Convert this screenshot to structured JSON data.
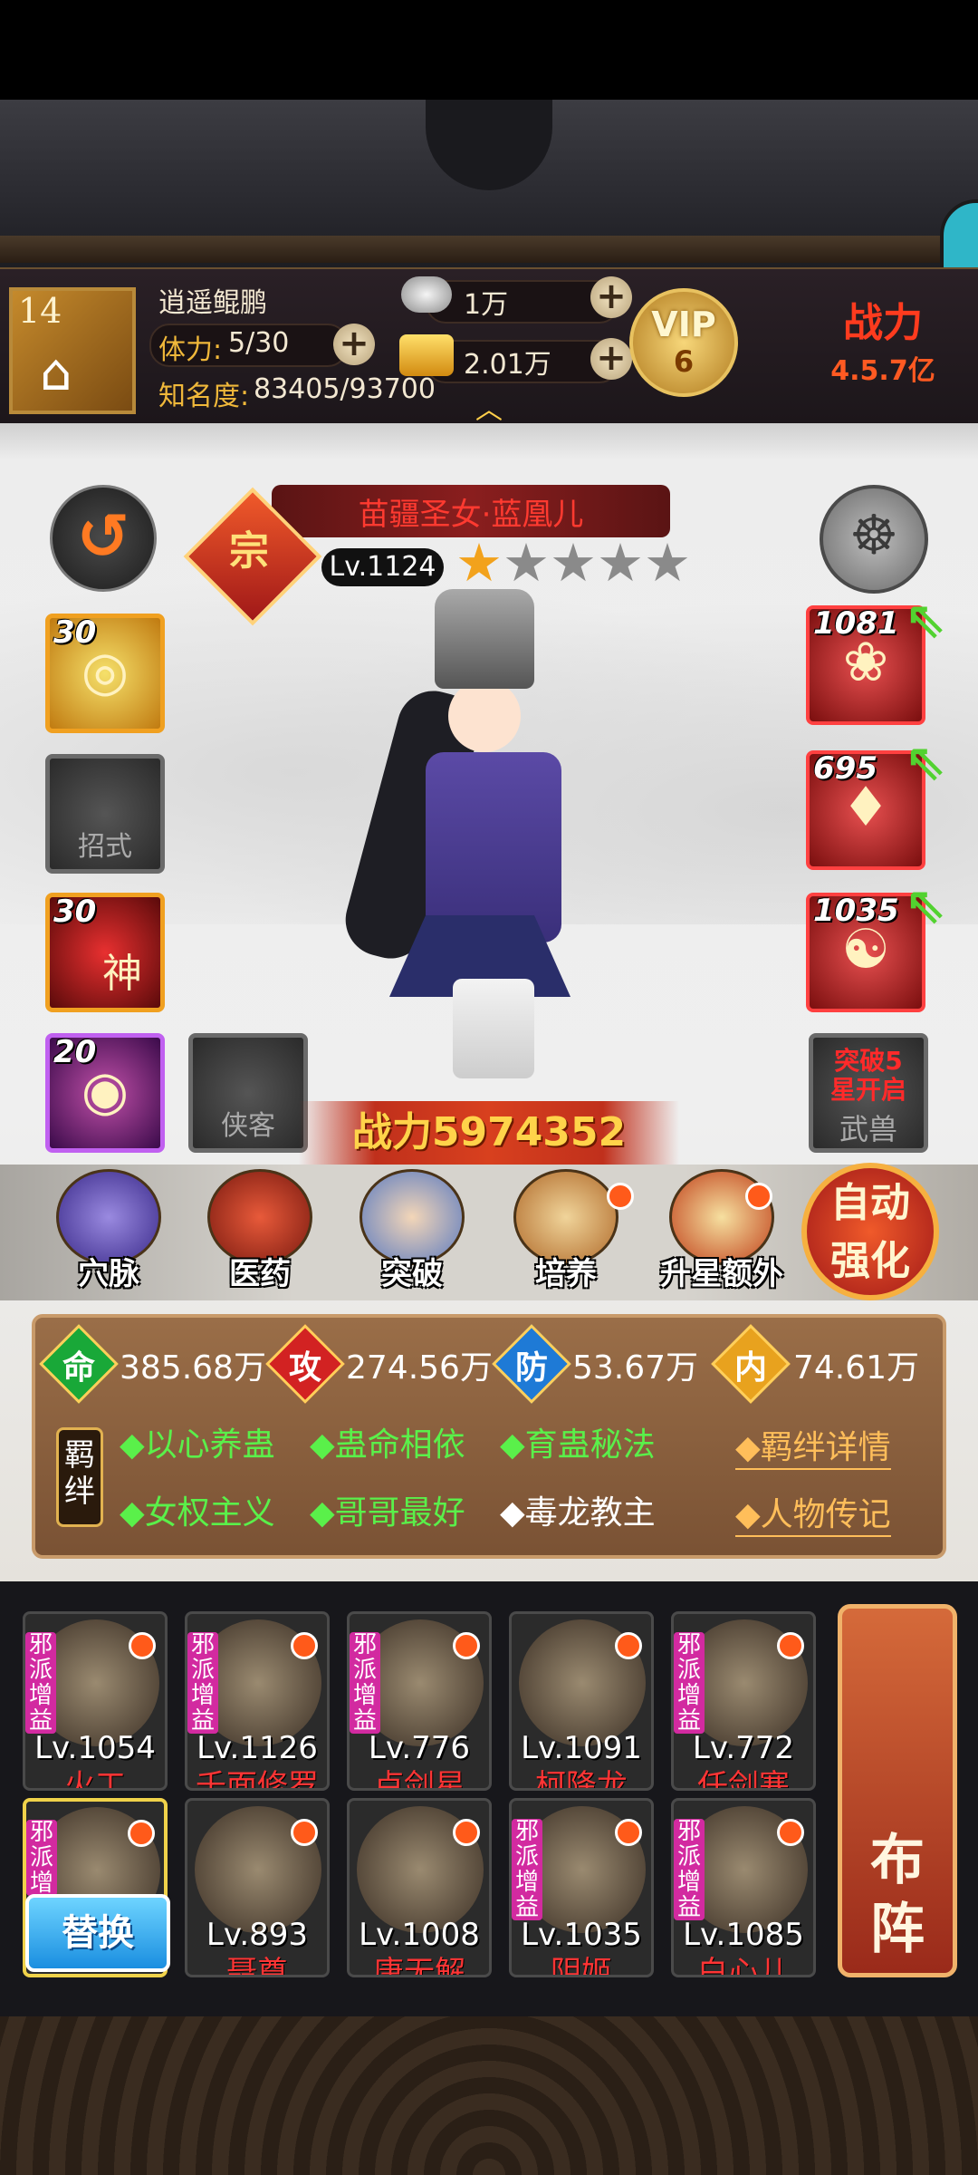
{
  "player": {
    "level": "14",
    "name": "逍遥鲲鹏",
    "stamina_label": "体力:",
    "stamina_value": "5/30",
    "fame_label": "知名度:",
    "fame_value": "83405/93700",
    "silver": "1万",
    "gold": "2.01万",
    "vip_label": "VIP",
    "vip_level": "6",
    "power_label": "战力",
    "power_value": "4.5.7亿"
  },
  "hero": {
    "rank_badge": "宗",
    "name": "苗疆圣女·蓝凰儿",
    "level": "Lv.1124",
    "stars_total": 5,
    "stars_lit": 1,
    "power_text": "战力5974352"
  },
  "skills": [
    {
      "level": "30",
      "type": "gold"
    },
    {
      "caption": "招式",
      "type": "empty"
    },
    {
      "level": "30",
      "type": "red",
      "glyph": "神"
    },
    {
      "level": "20",
      "type": "purple"
    }
  ],
  "xiake_slot": {
    "caption": "侠客"
  },
  "equipment": [
    {
      "level": "1081"
    },
    {
      "level": "695"
    },
    {
      "level": "1035"
    }
  ],
  "wushou": {
    "line1": "突破5",
    "line2": "星开启",
    "caption": "武兽"
  },
  "functions": [
    {
      "label": "穴脉",
      "dot": false
    },
    {
      "label": "医药",
      "dot": false
    },
    {
      "label": "突破",
      "dot": false
    },
    {
      "label": "培养",
      "dot": true
    },
    {
      "label": "升星额外",
      "dot": true
    }
  ],
  "auto_btn": {
    "line1": "自动",
    "line2": "强化"
  },
  "stats": [
    {
      "char": "命",
      "value": "385.68万",
      "color": "#19a838"
    },
    {
      "char": "攻",
      "value": "274.56万",
      "color": "#d22222"
    },
    {
      "char": "防",
      "value": "53.67万",
      "color": "#1e7ad6"
    },
    {
      "char": "内",
      "value": "74.61万",
      "color": "#e8a21e"
    }
  ],
  "fetter_tag": "羁绊",
  "fetters": [
    {
      "text": "◆以心养蛊",
      "active": true
    },
    {
      "text": "◆蛊命相依",
      "active": true
    },
    {
      "text": "◆育蛊秘法",
      "active": true
    },
    {
      "text": "◆女权主义",
      "active": true
    },
    {
      "text": "◆哥哥最好",
      "active": true
    },
    {
      "text": "◆毒龙教主",
      "active": false
    }
  ],
  "fetter_links": [
    "◆羁绊详情",
    "◆人物传记"
  ],
  "team": [
    {
      "level": "Lv.1054",
      "name": "火工",
      "tag": "邪派增益"
    },
    {
      "level": "Lv.1126",
      "name": "千面修罗",
      "tag": "邪派增益"
    },
    {
      "level": "Lv.776",
      "name": "卢剑星",
      "tag": "邪派增益"
    },
    {
      "level": "Lv.1091",
      "name": "柯降龙",
      "tag": ""
    },
    {
      "level": "Lv.772",
      "name": "任剑寒",
      "tag": "邪派增益"
    },
    {
      "level": "",
      "name": "",
      "tag": "邪派增"
    },
    {
      "level": "Lv.893",
      "name": "聂尊",
      "tag": ""
    },
    {
      "level": "Lv.1008",
      "name": "唐无解",
      "tag": ""
    },
    {
      "level": "Lv.1035",
      "name": "阴姬",
      "tag": "邪派增益"
    },
    {
      "level": "Lv.1085",
      "name": "白心儿",
      "tag": "邪派增益"
    }
  ],
  "swap_btn": "替换",
  "buzhen": {
    "line1": "布",
    "line2": "阵"
  }
}
